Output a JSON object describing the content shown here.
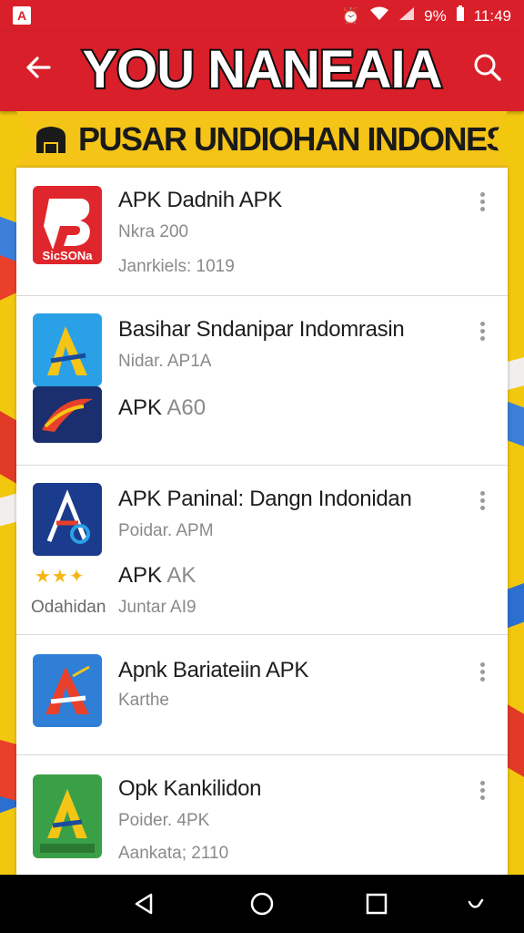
{
  "status": {
    "time": "11:49",
    "battery_label": "9%"
  },
  "header": {
    "title": "YOU NANEAIA",
    "back_icon": "arrow-left-icon",
    "search_icon": "search-icon"
  },
  "banner": {
    "text": "PUSAR UNDIOHAN INDONESIA",
    "icon": "store-icon"
  },
  "items": [
    {
      "name": "APK Dadnih APK",
      "line1": "Nkra 200",
      "line2": "Janrkiels: 1019",
      "icon_caption": "SicSONa",
      "icon_color": "#e0262d"
    },
    {
      "name": "Basihar Sndanipar Indomrasin",
      "line1": "Nidar. AP1A",
      "line2_dark": "APK",
      "line2_grey": "A60",
      "icon_color": "#2aa0e6"
    },
    {
      "name": "APK Paninal: Dangn Indonidan",
      "line1": "Poidar. APM",
      "line2_dark": "APK",
      "line2_grey": "AK",
      "line3": "Juntar AI9",
      "rating_stars": "★★✦",
      "side_label": "Odahidan",
      "icon_color": "#1b4b9c"
    },
    {
      "name": "Apnk Bariateiin APK",
      "line1": "Karthe",
      "icon_color": "#2f7fd6"
    },
    {
      "name": "Opk Kankilidon",
      "line1": "Poider. 4PK",
      "line2": "Aankata; 2110",
      "icon_color": "#3aa048"
    }
  ],
  "nav": {
    "back": "back-triangle-icon",
    "home": "home-circle-icon",
    "recents": "recents-square-icon",
    "extra": "keyboard-icon"
  }
}
